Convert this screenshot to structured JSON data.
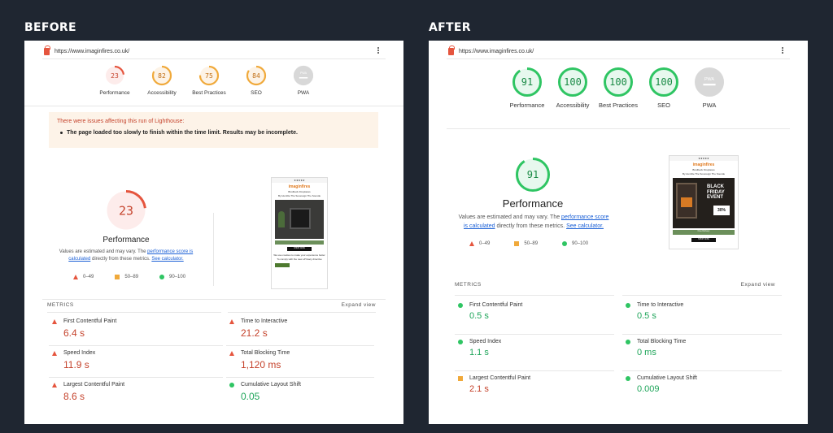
{
  "before": {
    "title": "BEFORE",
    "url": "https://www.imaginfires.co.uk/",
    "gauges": [
      {
        "label": "Performance",
        "score": "23",
        "status": "fail",
        "ratio": 0.23
      },
      {
        "label": "Accessibility",
        "score": "82",
        "status": "average",
        "ratio": 0.82
      },
      {
        "label": "Best Practices",
        "score": "75",
        "status": "average",
        "ratio": 0.75
      },
      {
        "label": "SEO",
        "score": "84",
        "status": "average",
        "ratio": 0.84
      },
      {
        "label": "PWA",
        "score": "PWA",
        "status": "na",
        "ratio": 0
      }
    ],
    "warning": {
      "title": "There were issues affecting this run of Lighthouse:",
      "item": "The page loaded too slowly to finish within the time limit. Results may be incomplete."
    },
    "big_gauge": {
      "score": "23",
      "label": "Performance",
      "ratio": 0.23
    },
    "note": {
      "pre": "Values are estimated and may vary. The ",
      "link": "performance score is calculated",
      "mid": " directly from these metrics. ",
      "link2": "See calculator."
    },
    "legend": [
      "0–49",
      "50–89",
      "90–100"
    ],
    "metrics_label": "METRICS",
    "expand": "Expand view",
    "metrics": [
      {
        "name": "First Contentful Paint",
        "value": "6.4 s",
        "status": "fail"
      },
      {
        "name": "Time to Interactive",
        "value": "21.2 s",
        "status": "fail"
      },
      {
        "name": "Speed Index",
        "value": "11.9 s",
        "status": "fail"
      },
      {
        "name": "Total Blocking Time",
        "value": "1,120 ms",
        "status": "fail"
      },
      {
        "name": "Largest Contentful Paint",
        "value": "8.6 s",
        "status": "fail"
      },
      {
        "name": "Cumulative Layout Shift",
        "value": "0.05",
        "status": "pass"
      }
    ]
  },
  "after": {
    "title": "AFTER",
    "url": "https://www.imaginfires.co.uk/",
    "gauges": [
      {
        "label": "Performance",
        "score": "91",
        "status": "pass",
        "ratio": 0.91
      },
      {
        "label": "Accessibility",
        "score": "100",
        "status": "pass",
        "ratio": 1.0
      },
      {
        "label": "Best Practices",
        "score": "100",
        "status": "pass",
        "ratio": 1.0
      },
      {
        "label": "SEO",
        "score": "100",
        "status": "pass",
        "ratio": 1.0
      },
      {
        "label": "PWA",
        "score": "PWA",
        "status": "na",
        "ratio": 0
      }
    ],
    "big_gauge": {
      "score": "91",
      "label": "Performance",
      "ratio": 0.91
    },
    "note": {
      "pre": "Values are estimated and may vary. The ",
      "link": "performance score is calculated",
      "mid": " directly from these metrics. ",
      "link2": "See calculator."
    },
    "legend": [
      "0–49",
      "50–89",
      "90–100"
    ],
    "metrics_label": "METRICS",
    "expand": "Expand view",
    "metrics": [
      {
        "name": "First Contentful Paint",
        "value": "0.5 s",
        "status": "pass"
      },
      {
        "name": "Time to Interactive",
        "value": "0.5 s",
        "status": "pass"
      },
      {
        "name": "Speed Index",
        "value": "1.1 s",
        "status": "pass"
      },
      {
        "name": "Total Blocking Time",
        "value": "0 ms",
        "status": "pass"
      },
      {
        "name": "Largest Contentful Paint",
        "value": "2.1 s",
        "status": "average"
      },
      {
        "name": "Cumulative Layout Shift",
        "value": "0.009",
        "status": "pass"
      }
    ]
  },
  "colors": {
    "fail": "#e5553e",
    "average": "#f0a93a",
    "pass": "#2fc563",
    "na": "#cccccc",
    "background": "#1f2631"
  }
}
